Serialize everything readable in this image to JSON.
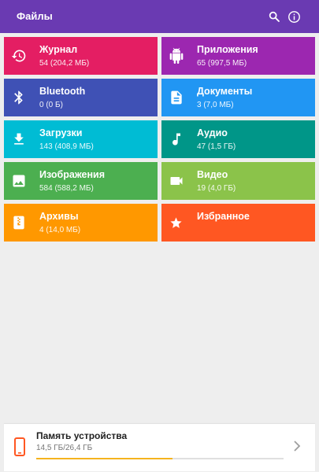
{
  "appbar": {
    "title": "Файлы",
    "search_icon": "search-icon",
    "info_icon": "info-icon",
    "bg": "#6a3ab2"
  },
  "categories": [
    {
      "id": "journal",
      "label": "Журнал",
      "meta": "54 (204,2 МБ)",
      "color": "#e41e63",
      "icon": "history-icon"
    },
    {
      "id": "apps",
      "label": "Приложения",
      "meta": "65 (997,5 МБ)",
      "color": "#9c27b0",
      "icon": "android-icon"
    },
    {
      "id": "bluetooth",
      "label": "Bluetooth",
      "meta": "0 (0 Б)",
      "color": "#3f51b5",
      "icon": "bluetooth-icon"
    },
    {
      "id": "documents",
      "label": "Документы",
      "meta": "3 (7,0 МБ)",
      "color": "#2196f3",
      "icon": "document-icon"
    },
    {
      "id": "downloads",
      "label": "Загрузки",
      "meta": "143 (408,9 МБ)",
      "color": "#00bcd4",
      "icon": "download-icon"
    },
    {
      "id": "audio",
      "label": "Аудио",
      "meta": "47 (1,5 ГБ)",
      "color": "#009688",
      "icon": "music-note-icon"
    },
    {
      "id": "images",
      "label": "Изображения",
      "meta": "584 (588,2 МБ)",
      "color": "#4caf50",
      "icon": "image-icon"
    },
    {
      "id": "video",
      "label": "Видео",
      "meta": "19 (4,0 ГБ)",
      "color": "#8bc34a",
      "icon": "videocam-icon"
    },
    {
      "id": "archives",
      "label": "Архивы",
      "meta": "4 (14,0 МБ)",
      "color": "#ff9800",
      "icon": "archive-icon"
    },
    {
      "id": "favorites",
      "label": "Избранное",
      "meta": "",
      "color": "#ff5722",
      "icon": "star-icon"
    }
  ],
  "storage": {
    "label": "Память устройства",
    "usage": "14,5 ГБ/26,4 ГБ",
    "used_fraction": 0.55,
    "accent": "#f5b31e",
    "icon": "phone-icon"
  }
}
